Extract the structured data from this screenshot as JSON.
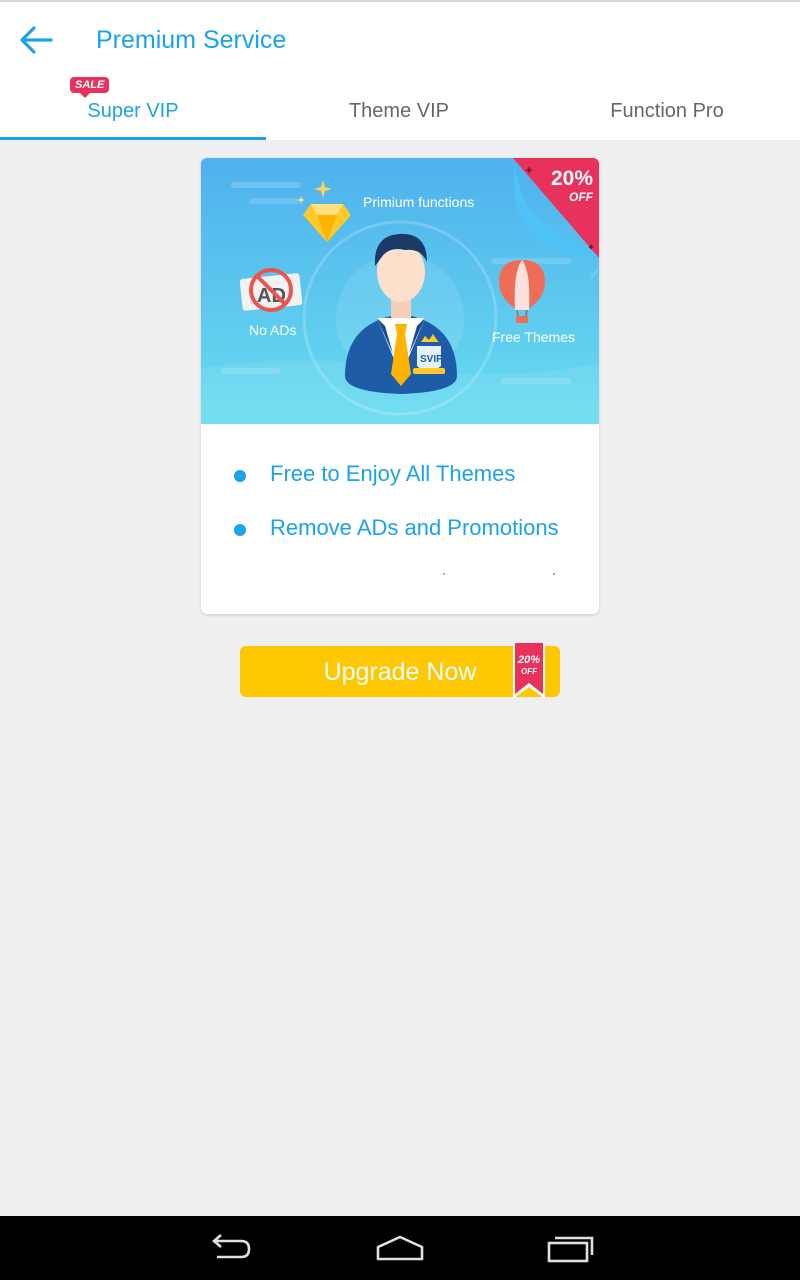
{
  "header": {
    "title": "Premium Service",
    "back_icon": "arrow-left-icon"
  },
  "tabs": [
    {
      "label": "Super VIP",
      "active": true,
      "badge": "SALE"
    },
    {
      "label": "Theme VIP",
      "active": false
    },
    {
      "label": "Function Pro",
      "active": false
    }
  ],
  "card": {
    "hero": {
      "premium_label": "Primium functions",
      "no_ads_label": "No ADs",
      "free_themes_label": "Free Themes",
      "ad_sign_text": "AD",
      "badge_text": "SVIP",
      "discount_percent": "20%",
      "discount_off": "OFF"
    },
    "features": [
      "Free to Enjoy All Themes",
      "Remove ADs and Promotions"
    ]
  },
  "upgrade": {
    "label": "Upgrade Now",
    "ribbon_percent": "20%",
    "ribbon_off": "OFF"
  },
  "navbar": {
    "icons": [
      "back-icon",
      "home-icon",
      "recent-apps-icon"
    ]
  },
  "colors": {
    "accent": "#1aa3e8",
    "sale": "#e8315b",
    "upgrade": "#fec800",
    "background": "#efefef"
  }
}
